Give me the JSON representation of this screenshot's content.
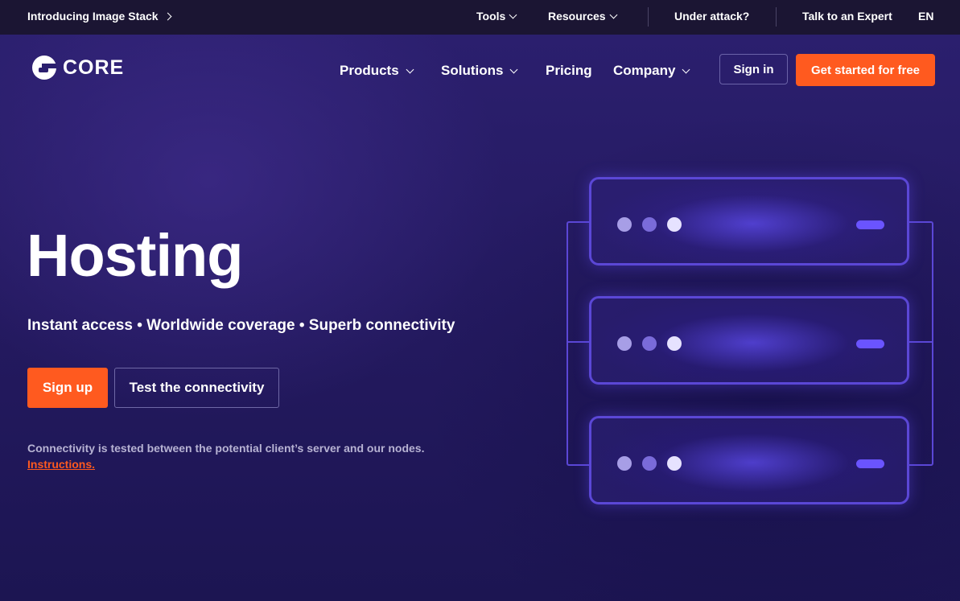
{
  "topbar": {
    "promo": "Introducing Image Stack",
    "tools": "Tools",
    "resources": "Resources",
    "under_attack": "Under attack?",
    "talk_expert": "Talk to an Expert",
    "language": "EN"
  },
  "header": {
    "logo_text": "CORE",
    "nav": {
      "products": "Products",
      "solutions": "Solutions",
      "pricing": "Pricing",
      "company": "Company"
    },
    "sign_in": "Sign in",
    "get_started": "Get started for free"
  },
  "hero": {
    "title": "Hosting",
    "subtitle": "Instant access • Worldwide coverage • Superb connectivity",
    "sign_up": "Sign up",
    "test_connectivity": "Test the connectivity",
    "note": "Connectivity is tested between the potential client’s server and our nodes.",
    "instructions_link": "Instructions."
  },
  "colors": {
    "accent": "#ff5a1f",
    "topbar_bg": "#1b1533",
    "hero_bg": "#2b1f6e",
    "server_outline": "#5b47d6"
  }
}
